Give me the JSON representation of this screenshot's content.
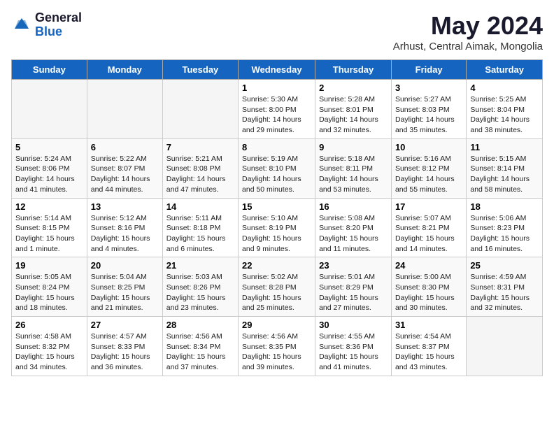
{
  "logo": {
    "general": "General",
    "blue": "Blue"
  },
  "title": "May 2024",
  "location": "Arhust, Central Aimak, Mongolia",
  "days_of_week": [
    "Sunday",
    "Monday",
    "Tuesday",
    "Wednesday",
    "Thursday",
    "Friday",
    "Saturday"
  ],
  "weeks": [
    [
      {
        "day": "",
        "info": ""
      },
      {
        "day": "",
        "info": ""
      },
      {
        "day": "",
        "info": ""
      },
      {
        "day": "1",
        "info": "Sunrise: 5:30 AM\nSunset: 8:00 PM\nDaylight: 14 hours\nand 29 minutes."
      },
      {
        "day": "2",
        "info": "Sunrise: 5:28 AM\nSunset: 8:01 PM\nDaylight: 14 hours\nand 32 minutes."
      },
      {
        "day": "3",
        "info": "Sunrise: 5:27 AM\nSunset: 8:03 PM\nDaylight: 14 hours\nand 35 minutes."
      },
      {
        "day": "4",
        "info": "Sunrise: 5:25 AM\nSunset: 8:04 PM\nDaylight: 14 hours\nand 38 minutes."
      }
    ],
    [
      {
        "day": "5",
        "info": "Sunrise: 5:24 AM\nSunset: 8:06 PM\nDaylight: 14 hours\nand 41 minutes."
      },
      {
        "day": "6",
        "info": "Sunrise: 5:22 AM\nSunset: 8:07 PM\nDaylight: 14 hours\nand 44 minutes."
      },
      {
        "day": "7",
        "info": "Sunrise: 5:21 AM\nSunset: 8:08 PM\nDaylight: 14 hours\nand 47 minutes."
      },
      {
        "day": "8",
        "info": "Sunrise: 5:19 AM\nSunset: 8:10 PM\nDaylight: 14 hours\nand 50 minutes."
      },
      {
        "day": "9",
        "info": "Sunrise: 5:18 AM\nSunset: 8:11 PM\nDaylight: 14 hours\nand 53 minutes."
      },
      {
        "day": "10",
        "info": "Sunrise: 5:16 AM\nSunset: 8:12 PM\nDaylight: 14 hours\nand 55 minutes."
      },
      {
        "day": "11",
        "info": "Sunrise: 5:15 AM\nSunset: 8:14 PM\nDaylight: 14 hours\nand 58 minutes."
      }
    ],
    [
      {
        "day": "12",
        "info": "Sunrise: 5:14 AM\nSunset: 8:15 PM\nDaylight: 15 hours\nand 1 minute."
      },
      {
        "day": "13",
        "info": "Sunrise: 5:12 AM\nSunset: 8:16 PM\nDaylight: 15 hours\nand 4 minutes."
      },
      {
        "day": "14",
        "info": "Sunrise: 5:11 AM\nSunset: 8:18 PM\nDaylight: 15 hours\nand 6 minutes."
      },
      {
        "day": "15",
        "info": "Sunrise: 5:10 AM\nSunset: 8:19 PM\nDaylight: 15 hours\nand 9 minutes."
      },
      {
        "day": "16",
        "info": "Sunrise: 5:08 AM\nSunset: 8:20 PM\nDaylight: 15 hours\nand 11 minutes."
      },
      {
        "day": "17",
        "info": "Sunrise: 5:07 AM\nSunset: 8:21 PM\nDaylight: 15 hours\nand 14 minutes."
      },
      {
        "day": "18",
        "info": "Sunrise: 5:06 AM\nSunset: 8:23 PM\nDaylight: 15 hours\nand 16 minutes."
      }
    ],
    [
      {
        "day": "19",
        "info": "Sunrise: 5:05 AM\nSunset: 8:24 PM\nDaylight: 15 hours\nand 18 minutes."
      },
      {
        "day": "20",
        "info": "Sunrise: 5:04 AM\nSunset: 8:25 PM\nDaylight: 15 hours\nand 21 minutes."
      },
      {
        "day": "21",
        "info": "Sunrise: 5:03 AM\nSunset: 8:26 PM\nDaylight: 15 hours\nand 23 minutes."
      },
      {
        "day": "22",
        "info": "Sunrise: 5:02 AM\nSunset: 8:28 PM\nDaylight: 15 hours\nand 25 minutes."
      },
      {
        "day": "23",
        "info": "Sunrise: 5:01 AM\nSunset: 8:29 PM\nDaylight: 15 hours\nand 27 minutes."
      },
      {
        "day": "24",
        "info": "Sunrise: 5:00 AM\nSunset: 8:30 PM\nDaylight: 15 hours\nand 30 minutes."
      },
      {
        "day": "25",
        "info": "Sunrise: 4:59 AM\nSunset: 8:31 PM\nDaylight: 15 hours\nand 32 minutes."
      }
    ],
    [
      {
        "day": "26",
        "info": "Sunrise: 4:58 AM\nSunset: 8:32 PM\nDaylight: 15 hours\nand 34 minutes."
      },
      {
        "day": "27",
        "info": "Sunrise: 4:57 AM\nSunset: 8:33 PM\nDaylight: 15 hours\nand 36 minutes."
      },
      {
        "day": "28",
        "info": "Sunrise: 4:56 AM\nSunset: 8:34 PM\nDaylight: 15 hours\nand 37 minutes."
      },
      {
        "day": "29",
        "info": "Sunrise: 4:56 AM\nSunset: 8:35 PM\nDaylight: 15 hours\nand 39 minutes."
      },
      {
        "day": "30",
        "info": "Sunrise: 4:55 AM\nSunset: 8:36 PM\nDaylight: 15 hours\nand 41 minutes."
      },
      {
        "day": "31",
        "info": "Sunrise: 4:54 AM\nSunset: 8:37 PM\nDaylight: 15 hours\nand 43 minutes."
      },
      {
        "day": "",
        "info": ""
      }
    ]
  ]
}
